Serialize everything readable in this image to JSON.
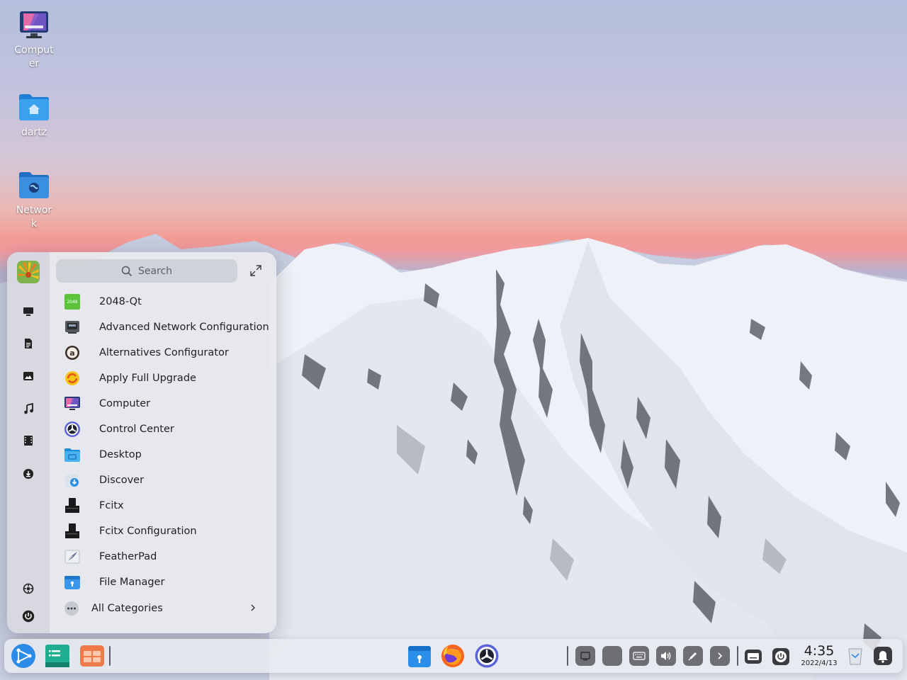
{
  "desktop": {
    "icons": [
      {
        "label": "Computer",
        "icon": "computer-icon"
      },
      {
        "label": "dartz",
        "icon": "home-folder-icon"
      },
      {
        "label": "Network",
        "icon": "network-folder-icon"
      }
    ]
  },
  "launcher": {
    "search_placeholder": "Search",
    "sidebar": [
      "computer-icon",
      "document-icon",
      "picture-icon",
      "music-icon",
      "video-icon",
      "download-icon",
      "settings-icon",
      "power-icon"
    ],
    "apps": [
      {
        "name": "2048-Qt",
        "icon": "2048-icon"
      },
      {
        "name": "Advanced Network Configuration",
        "icon": "network-config-icon"
      },
      {
        "name": "Alternatives Configurator",
        "icon": "alternatives-icon"
      },
      {
        "name": "Apply Full Upgrade",
        "icon": "upgrade-icon"
      },
      {
        "name": "Computer",
        "icon": "computer-icon"
      },
      {
        "name": "Control Center",
        "icon": "control-center-icon"
      },
      {
        "name": "Desktop",
        "icon": "desktop-folder-icon"
      },
      {
        "name": "Discover",
        "icon": "discover-icon"
      },
      {
        "name": "Fcitx",
        "icon": "keyboard-icon"
      },
      {
        "name": "Fcitx Configuration",
        "icon": "keyboard-config-icon"
      },
      {
        "name": "FeatherPad",
        "icon": "featherpad-icon"
      },
      {
        "name": "File Manager",
        "icon": "file-manager-icon"
      }
    ],
    "all_categories": "All Categories"
  },
  "dock": {
    "left": [
      "launcher-icon",
      "multitask-icon",
      "workspace-icon"
    ],
    "center": [
      "app-store-icon",
      "firefox-icon",
      "control-center-icon"
    ],
    "tray": [
      "screen-record-icon",
      "tray-blank-icon",
      "keyboard-icon",
      "volume-icon",
      "pen-icon",
      "arrow-right-icon",
      "input-method-icon",
      "power-icon",
      "trash-icon",
      "notification-icon"
    ],
    "time": "4:35",
    "date": "2022/4/13"
  }
}
